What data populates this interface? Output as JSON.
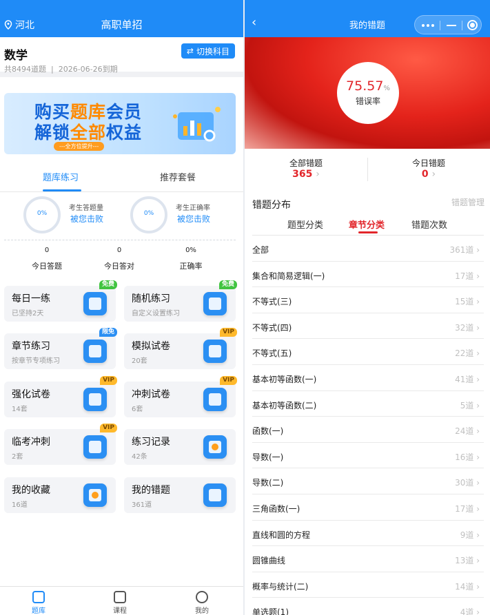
{
  "left": {
    "location": "河北",
    "header_title": "高职单招",
    "subject": {
      "name": "数学",
      "count": "共8494道题",
      "expiry": "2026-06-26到期",
      "switch_label": "切换科目"
    },
    "banner": {
      "line1_a": "购买",
      "line1_b": "题库",
      "line1_c": "会员",
      "line2_a": "解锁",
      "line2_b": "全部",
      "line2_c": "权益",
      "pill": "---全方位提升---"
    },
    "tabs": [
      "题库练习",
      "推荐套餐"
    ],
    "rates": [
      {
        "pct": "0%",
        "label": "考生答题量",
        "beat": "被您击败"
      },
      {
        "pct": "0%",
        "label": "考生正确率",
        "beat": "被您击败"
      }
    ],
    "stats": [
      {
        "value": "0",
        "label": "今日答题"
      },
      {
        "value": "0",
        "label": "今日答对"
      },
      {
        "value": "0%",
        "label": "正确率"
      }
    ],
    "cards": [
      {
        "title": "每日一练",
        "sub": "已坚持2天",
        "badge": "免费"
      },
      {
        "title": "随机练习",
        "sub": "自定义设置练习",
        "badge": "免费"
      },
      {
        "title": "章节练习",
        "sub": "按章节专项练习",
        "badge": "限免"
      },
      {
        "title": "模拟试卷",
        "sub": "20套",
        "badge": "VIP"
      },
      {
        "title": "强化试卷",
        "sub": "14套",
        "badge": "VIP"
      },
      {
        "title": "冲刺试卷",
        "sub": "6套",
        "badge": "VIP"
      },
      {
        "title": "临考冲刺",
        "sub": "2套",
        "badge": "VIP"
      },
      {
        "title": "练习记录",
        "sub": "42条",
        "badge": ""
      },
      {
        "title": "我的收藏",
        "sub": "16道",
        "badge": ""
      },
      {
        "title": "我的错题",
        "sub": "361道",
        "badge": ""
      }
    ],
    "nav": [
      "题库",
      "课程",
      "我的"
    ]
  },
  "right": {
    "header_title": "我的错题",
    "back": "‹",
    "rate_value": "75.57",
    "rate_unit": "%",
    "rate_label": "错误率",
    "total_label": "全部错题",
    "total_value": "365",
    "today_label": "今日错题",
    "today_value": "0",
    "dist_title": "错题分布",
    "manage_label": "错题管理",
    "tabs": [
      "题型分类",
      "章节分类",
      "错题次数"
    ],
    "rows": [
      {
        "name": "全部",
        "count": "361道"
      },
      {
        "name": "集合和简易逻辑(一)",
        "count": "17道"
      },
      {
        "name": "不等式(三)",
        "count": "15道"
      },
      {
        "name": "不等式(四)",
        "count": "32道"
      },
      {
        "name": "不等式(五)",
        "count": "22道"
      },
      {
        "name": "基本初等函数(一)",
        "count": "41道"
      },
      {
        "name": "基本初等函数(二)",
        "count": "5道"
      },
      {
        "name": "函数(一)",
        "count": "24道"
      },
      {
        "name": "导数(一)",
        "count": "16道"
      },
      {
        "name": "导数(二)",
        "count": "30道"
      },
      {
        "name": "三角函数(一)",
        "count": "17道"
      },
      {
        "name": "直线和圆的方程",
        "count": "9道"
      },
      {
        "name": "圆锥曲线",
        "count": "13道"
      },
      {
        "name": "概率与统计(二)",
        "count": "14道"
      },
      {
        "name": "单选题(1)",
        "count": "4道"
      }
    ],
    "chevron": "›"
  }
}
